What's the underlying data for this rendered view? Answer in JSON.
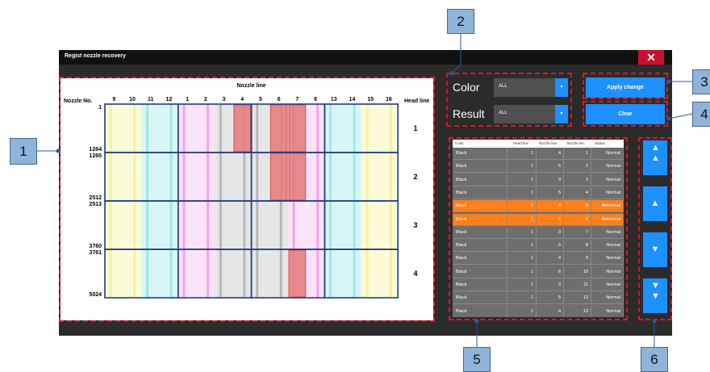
{
  "window": {
    "title": "Regist nozzle recovery",
    "close_glyph": "✕"
  },
  "map": {
    "nozzle_no_header": "Nozzle No.",
    "nozzle_line_header": "Nozzle line",
    "head_line_header": "Head line",
    "columns": [
      "9",
      "10",
      "11",
      "12",
      "1",
      "2",
      "3",
      "4",
      "5",
      "6",
      "7",
      "8",
      "13",
      "14",
      "15",
      "16"
    ],
    "nozzle_ranges": [
      [
        "1",
        "1264"
      ],
      [
        "1265",
        "2512"
      ],
      [
        "2513",
        "3760"
      ],
      [
        "3761",
        "5024"
      ]
    ],
    "head_lines": [
      "1",
      "2",
      "3",
      "4"
    ]
  },
  "filters": {
    "color_label": "Color",
    "color_value": "ALL",
    "result_label": "Result",
    "result_value": "ALL"
  },
  "actions": {
    "apply_label": "Apply change",
    "clear_label": "Clear"
  },
  "table": {
    "headers": [
      "Color",
      "Head line",
      "Nozzle line",
      "Nozzle No.",
      "Status"
    ],
    "rows": [
      [
        "Black",
        "1",
        "4",
        "1",
        "Normal"
      ],
      [
        "Black",
        "1",
        "6",
        "2",
        "Normal"
      ],
      [
        "Black",
        "1",
        "3",
        "3",
        "Normal"
      ],
      [
        "Black",
        "1",
        "5",
        "4",
        "Normal"
      ],
      [
        "Black",
        "1",
        "4",
        "5",
        "Abnormal"
      ],
      [
        "Black",
        "1",
        "6",
        "6",
        "Abnormal"
      ],
      [
        "Black",
        "1",
        "3",
        "7",
        "Normal"
      ],
      [
        "Black",
        "1",
        "5",
        "8",
        "Normal"
      ],
      [
        "Black",
        "1",
        "4",
        "9",
        "Normal"
      ],
      [
        "Black",
        "1",
        "6",
        "10",
        "Normal"
      ],
      [
        "Black",
        "1",
        "3",
        "11",
        "Normal"
      ],
      [
        "Black",
        "1",
        "5",
        "12",
        "Normal"
      ],
      [
        "Black",
        "1",
        "4",
        "13",
        "Normal"
      ]
    ],
    "highlight_color": "#ff7f1e"
  },
  "nav": {
    "top": "▲▲",
    "up": "▲",
    "down": "▼",
    "bottom": "▼▼"
  },
  "callouts": [
    "1",
    "2",
    "3",
    "4",
    "5",
    "6"
  ],
  "colors": {
    "accent": "#1e90ff",
    "callout_bg": "#8fb4da",
    "dash": "#e0142b",
    "close": "#c8102e",
    "grid_border": "#1f3c88"
  }
}
